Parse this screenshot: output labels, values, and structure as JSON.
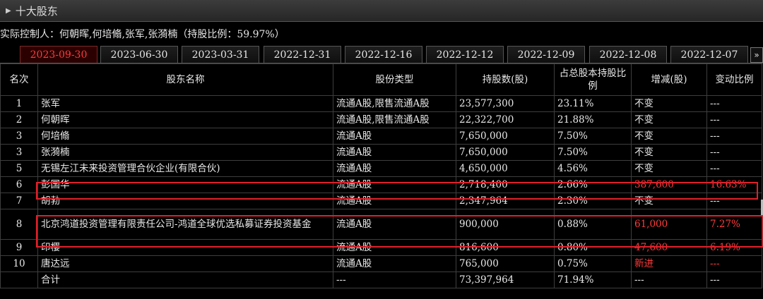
{
  "panel": {
    "title": "十大股东"
  },
  "controller": {
    "text": "实际控制人：何朝晖,何培翛,张军,张漪楠（持股比例：59.97%）"
  },
  "tabs": [
    {
      "label": "2023-09-30",
      "active": true
    },
    {
      "label": "2023-06-30",
      "active": false
    },
    {
      "label": "2023-03-31",
      "active": false
    },
    {
      "label": "2022-12-31",
      "active": false
    },
    {
      "label": "2022-12-16",
      "active": false
    },
    {
      "label": "2022-12-12",
      "active": false
    },
    {
      "label": "2022-12-09",
      "active": false
    },
    {
      "label": "2022-12-08",
      "active": false
    },
    {
      "label": "2022-12-07",
      "active": false
    }
  ],
  "tab_more": "»",
  "table": {
    "headers": [
      "名次",
      "股东名称",
      "股份类型",
      "持股数(股)",
      "占总股本持股比例",
      "增减(股)",
      "变动比例"
    ],
    "rows": [
      {
        "rank": "1",
        "name": "张军",
        "type": "流通A股,限售流通A股",
        "shares": "23,577,300",
        "pct": "23.11%",
        "change": "不变",
        "ratio": "---"
      },
      {
        "rank": "2",
        "name": "何朝晖",
        "type": "流通A股,限售流通A股",
        "shares": "22,322,700",
        "pct": "21.88%",
        "change": "不变",
        "ratio": "---"
      },
      {
        "rank": "3",
        "name": "何培翛",
        "type": "流通A股",
        "shares": "7,650,000",
        "pct": "7.50%",
        "change": "不变",
        "ratio": "---"
      },
      {
        "rank": "3",
        "name": "张漪楠",
        "type": "流通A股",
        "shares": "7,650,000",
        "pct": "7.50%",
        "change": "不变",
        "ratio": "---"
      },
      {
        "rank": "5",
        "name": "无锡左江未来投资管理合伙企业(有限合伙)",
        "type": "流通A股",
        "shares": "4,650,000",
        "pct": "4.56%",
        "change": "不变",
        "ratio": "---"
      },
      {
        "rank": "6",
        "name": "彭国华",
        "type": "流通A股",
        "shares": "2,718,400",
        "pct": "2.66%",
        "change": "387,600",
        "ratio": "16.63%"
      },
      {
        "rank": "7",
        "name": "胡勃",
        "type": "流通A股",
        "shares": "2,347,964",
        "pct": "2.30%",
        "change": "不变",
        "ratio": "---"
      },
      {
        "rank": "8",
        "name": "北京鸿道投资管理有限责任公司-鸿道全球优选私募证券投资基金",
        "type": "流通A股",
        "shares": "900,000",
        "pct": "0.88%",
        "change": "61,000",
        "ratio": "7.27%"
      },
      {
        "rank": "9",
        "name": "印樱",
        "type": "流通A股",
        "shares": "816,600",
        "pct": "0.80%",
        "change": "47,600",
        "ratio": "6.19%"
      },
      {
        "rank": "10",
        "name": "唐达远",
        "type": "流通A股",
        "shares": "765,000",
        "pct": "0.75%",
        "change": "新进",
        "ratio": "---"
      },
      {
        "rank": "",
        "name": "合计",
        "type": "---",
        "shares": "73,397,964",
        "pct": "71.94%",
        "change": "---",
        "ratio": "---"
      }
    ]
  },
  "colors": {
    "accent_red": "#ff3b3b",
    "highlight_box": "#e0202a",
    "background": "#000000"
  }
}
